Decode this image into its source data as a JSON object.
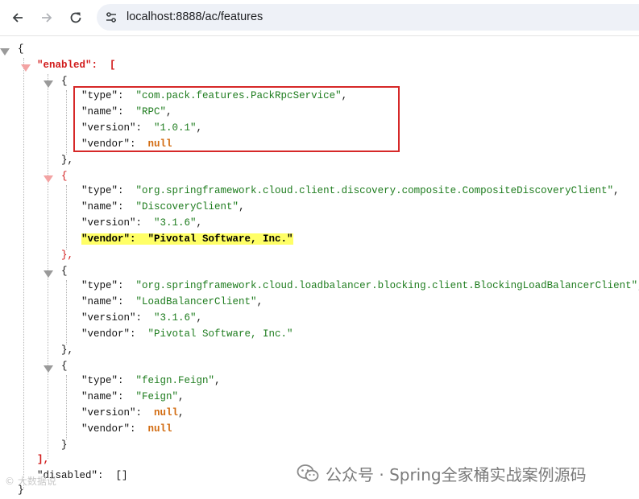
{
  "browser": {
    "url": "localhost:8888/ac/features",
    "icons": {
      "back": "arrow-left-icon",
      "forward": "arrow-right-icon",
      "reload": "reload-icon",
      "site_info": "site-info-icon"
    }
  },
  "json": {
    "open_brace": "{",
    "enabled_key": "\"enabled\"",
    "features": [
      {
        "type_key": "\"type\"",
        "type": "\"com.pack.features.PackRpcService\"",
        "name_key": "\"name\"",
        "name": "\"RPC\"",
        "version_key": "\"version\"",
        "version": "\"1.0.1\"",
        "vendor_key": "\"vendor\"",
        "vendor": "null"
      },
      {
        "type_key": "\"type\"",
        "type": "\"org.springframework.cloud.client.discovery.composite.CompositeDiscoveryClient\"",
        "name_key": "\"name\"",
        "name": "\"DiscoveryClient\"",
        "version_key": "\"version\"",
        "version": "\"3.1.6\"",
        "vendor_key": "\"vendor\"",
        "vendor": "\"Pivotal Software, Inc.\""
      },
      {
        "type_key": "\"type\"",
        "type": "\"org.springframework.cloud.loadbalancer.blocking.client.BlockingLoadBalancerClient\"",
        "name_key": "\"name\"",
        "name": "\"LoadBalancerClient\"",
        "version_key": "\"version\"",
        "version": "\"3.1.6\"",
        "vendor_key": "\"vendor\"",
        "vendor": "\"Pivotal Software, Inc.\""
      },
      {
        "type_key": "\"type\"",
        "type": "\"feign.Feign\"",
        "name_key": "\"name\"",
        "name": "\"Feign\"",
        "version_key": "\"version\"",
        "version": "null",
        "vendor_key": "\"vendor\"",
        "vendor": "null"
      }
    ],
    "disabled_key": "\"disabled\"",
    "disabled_value": "[]"
  },
  "watermark": {
    "text": "公众号 · Spring全家桶实战案例源码",
    "small_text": "© 大数据说"
  },
  "colors": {
    "highlight": "#ffff66",
    "box_border": "#d62828",
    "string": "#1e7c1e",
    "null": "#d26b10"
  }
}
